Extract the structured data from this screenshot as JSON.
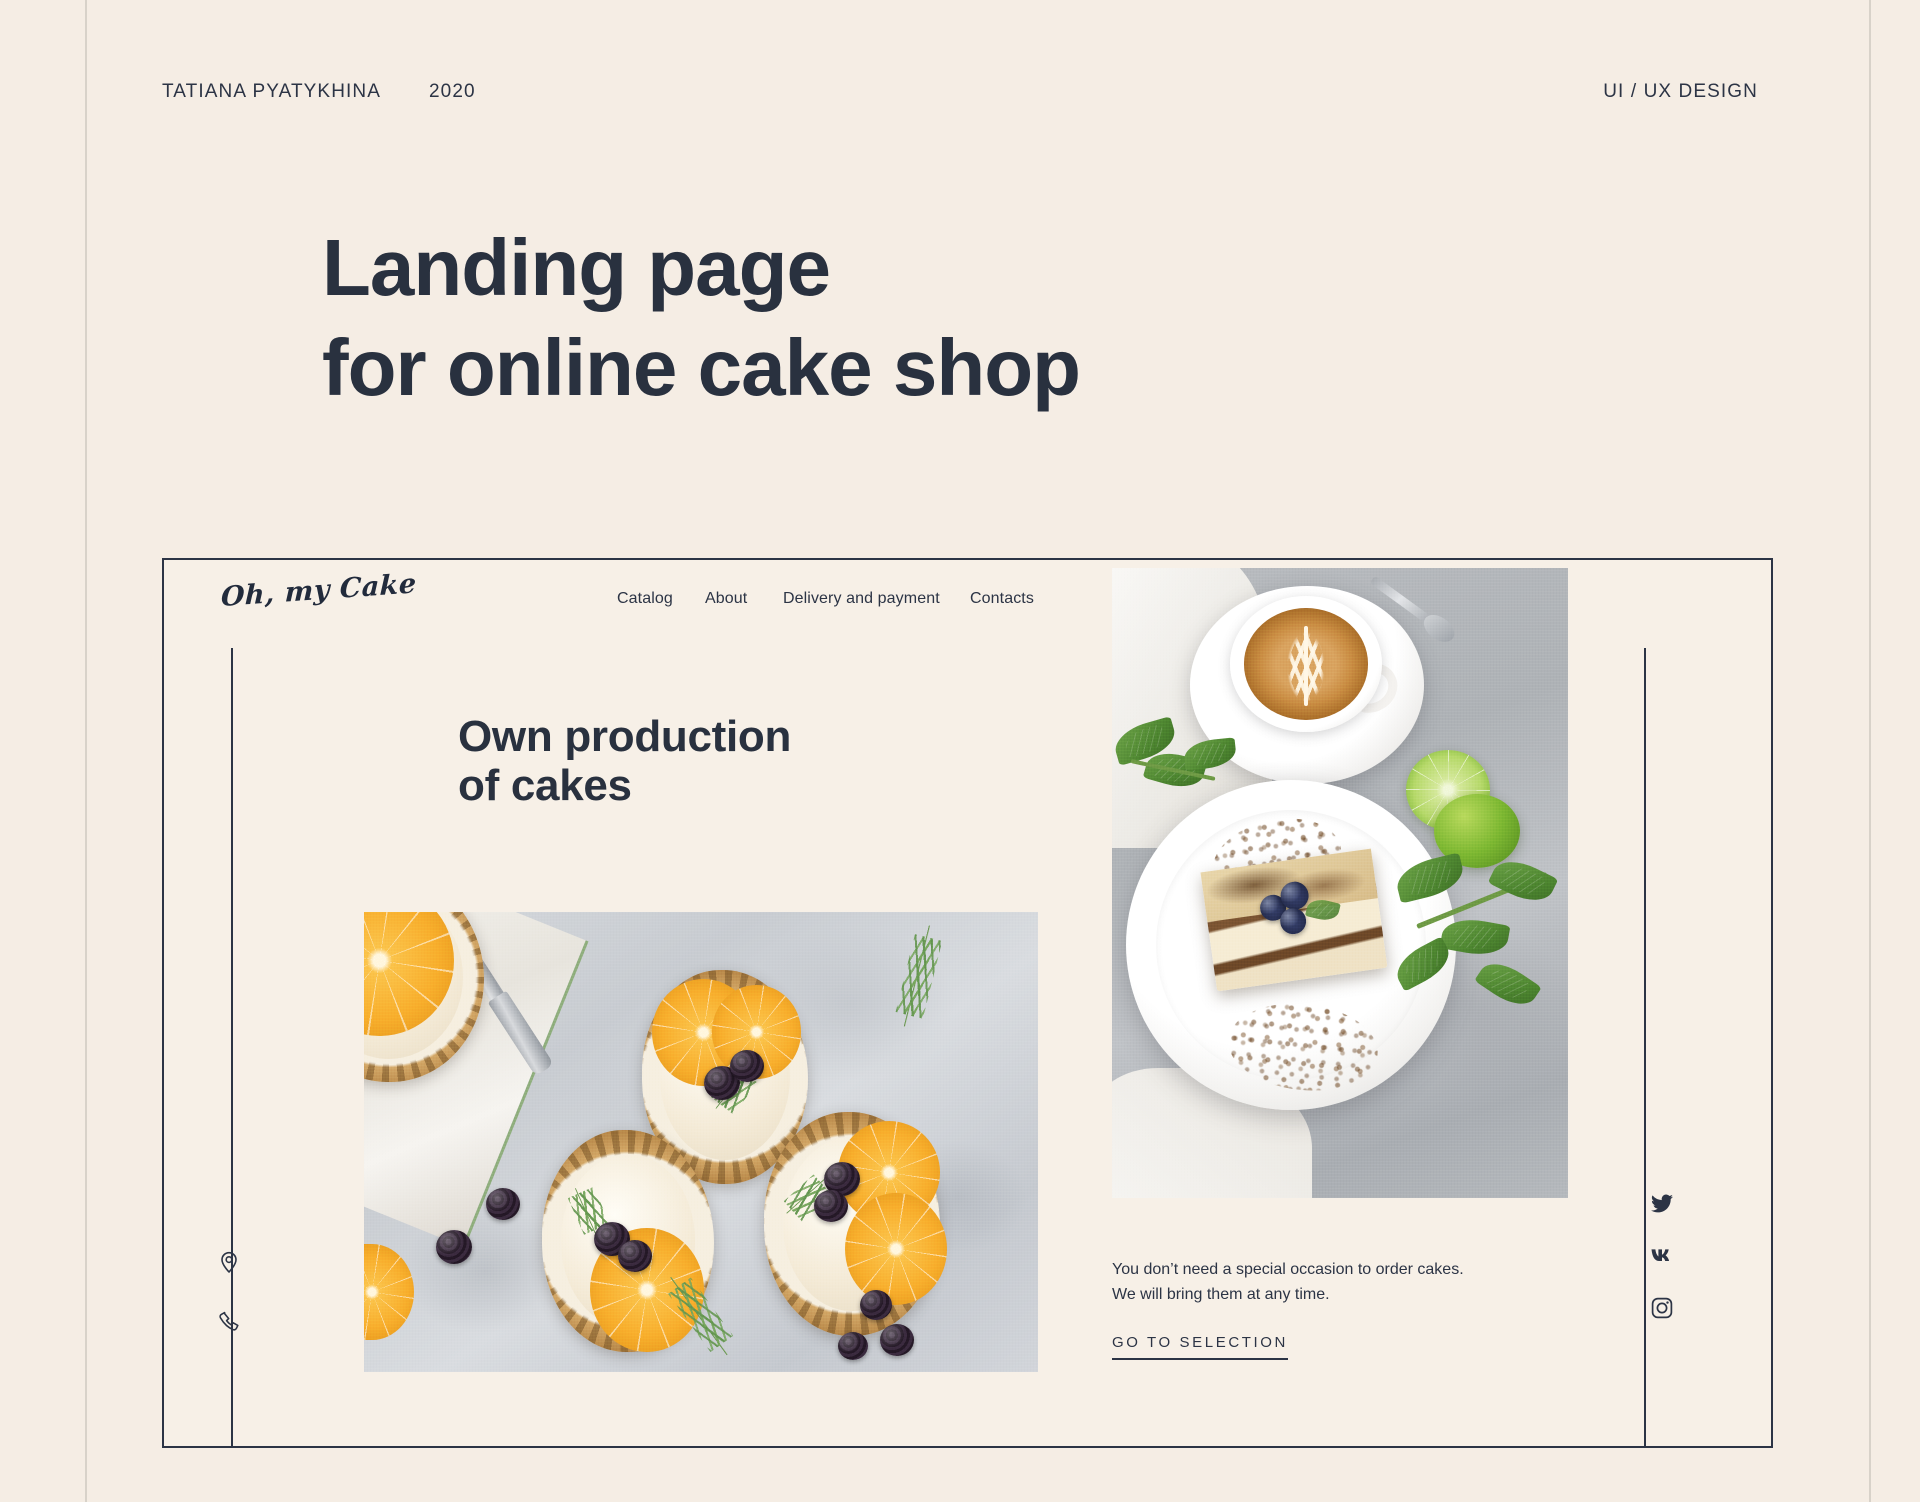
{
  "meta": {
    "author": "TATIANA PYATYKHINA",
    "year": "2020",
    "category": "UI / UX DESIGN"
  },
  "hero": {
    "line1": "Landing page",
    "line2": "for online cake shop"
  },
  "mockup": {
    "brand": "Oh, my Cake",
    "nav": [
      {
        "label": "Catalog"
      },
      {
        "label": "About"
      },
      {
        "label": "Delivery and payment"
      },
      {
        "label": "Contacts"
      }
    ],
    "cart_icon": "shopping-cart-icon",
    "headline": {
      "line1": "Own production",
      "line2": "of cakes"
    },
    "promo": {
      "line1": "You don’t need a special occasion to order cakes.",
      "line2": "We will bring them at any time."
    },
    "cta_label": "GO TO SELECTION",
    "contact_icons": [
      {
        "name": "location-pin-icon"
      },
      {
        "name": "phone-icon"
      }
    ],
    "social_icons": [
      {
        "name": "twitter-icon"
      },
      {
        "name": "vk-icon"
      },
      {
        "name": "instagram-icon"
      }
    ],
    "photos": [
      {
        "name": "photo-tarts",
        "alt": "Three orange cream tarts with blackberries and rosemary on concrete"
      },
      {
        "name": "photo-coffee-dessert",
        "alt": "Latte art coffee cup, tiramisu slice with blueberries, limes and mint"
      }
    ]
  },
  "colors": {
    "page_background": "#f5ede4",
    "mockup_background": "#f7f0e7",
    "ink": "#2c3445",
    "rule": "#d8d2c9"
  }
}
